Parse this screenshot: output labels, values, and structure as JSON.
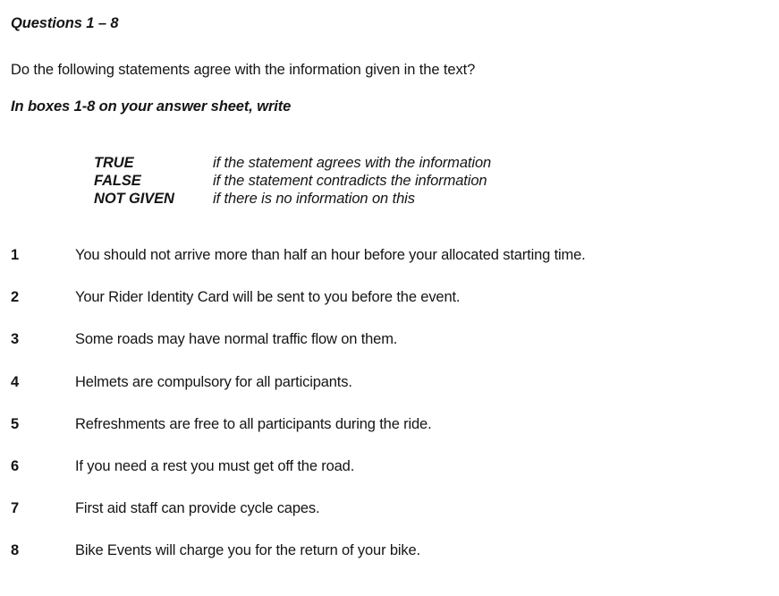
{
  "heading": "Questions 1 – 8",
  "prompt": "Do the following statements agree with the information given in the text?",
  "sub_instruction": "In boxes 1-8 on your answer sheet, write",
  "legend": [
    {
      "term": "TRUE",
      "description": "if the statement agrees with the information"
    },
    {
      "term": "FALSE",
      "description": "if the statement contradicts the information"
    },
    {
      "term": "NOT GIVEN",
      "description": "if there is no information on this"
    }
  ],
  "statements": [
    {
      "number": "1",
      "text": "You should not arrive more than half an hour before your allocated starting time."
    },
    {
      "number": "2",
      "text": "Your Rider Identity Card will be sent to you before the event."
    },
    {
      "number": "3",
      "text": "Some roads may have normal traffic flow on them."
    },
    {
      "number": "4",
      "text": "Helmets are compulsory for all participants."
    },
    {
      "number": "5",
      "text": "Refreshments are free to all participants during the ride."
    },
    {
      "number": "6",
      "text": "If you need a rest you must get off the road."
    },
    {
      "number": "7",
      "text": "First aid staff can provide cycle capes."
    },
    {
      "number": "8",
      "text": "Bike Events will charge you for the return of your bike."
    }
  ],
  "colors": {
    "text": "#151515",
    "background": "#ffffff"
  }
}
